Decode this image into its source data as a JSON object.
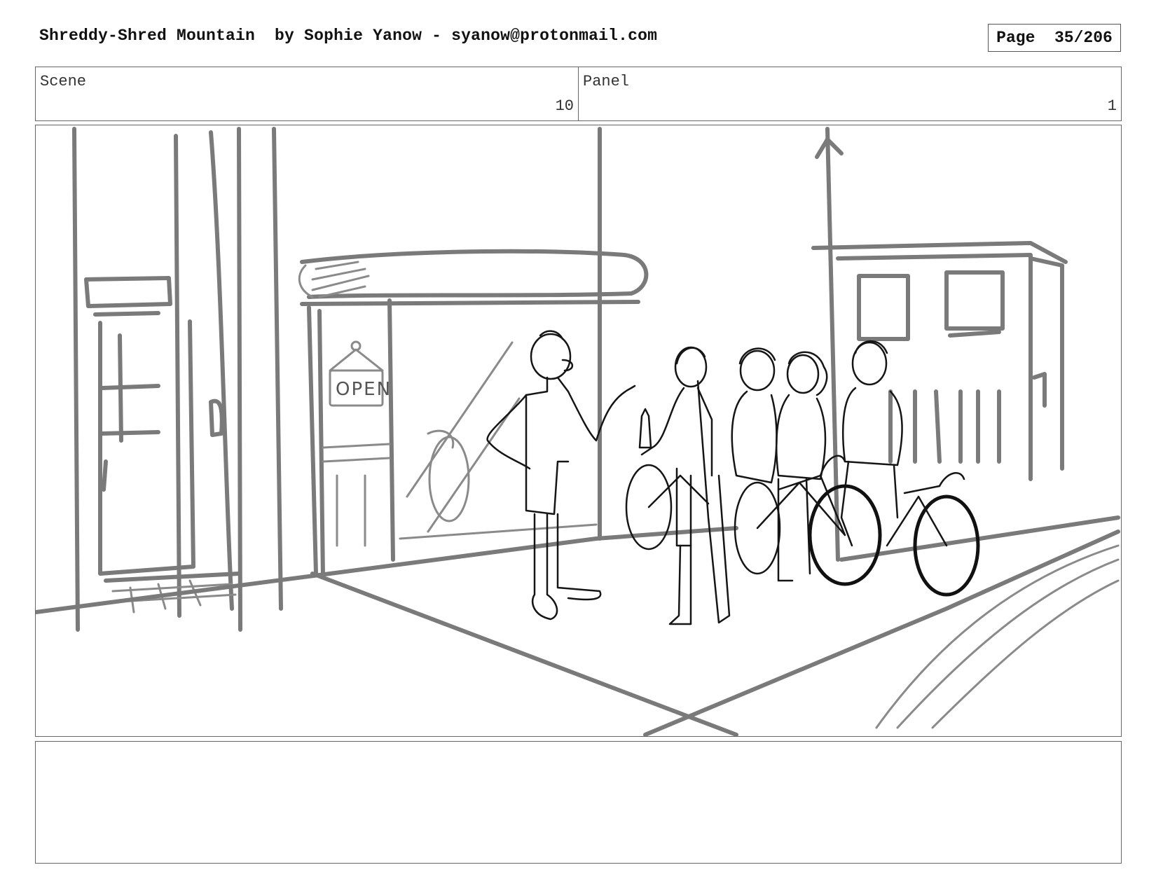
{
  "header": {
    "title": "Shreddy-Shred Mountain  by Sophie Yanow - syanow@protonmail.com",
    "page_label": "Page  35/206"
  },
  "info": {
    "scene_label": "Scene",
    "scene_value": "10",
    "panel_label": "Panel",
    "panel_value": "1"
  },
  "frame": {
    "sign_text": "OPEN"
  },
  "notes": {
    "text": ""
  }
}
